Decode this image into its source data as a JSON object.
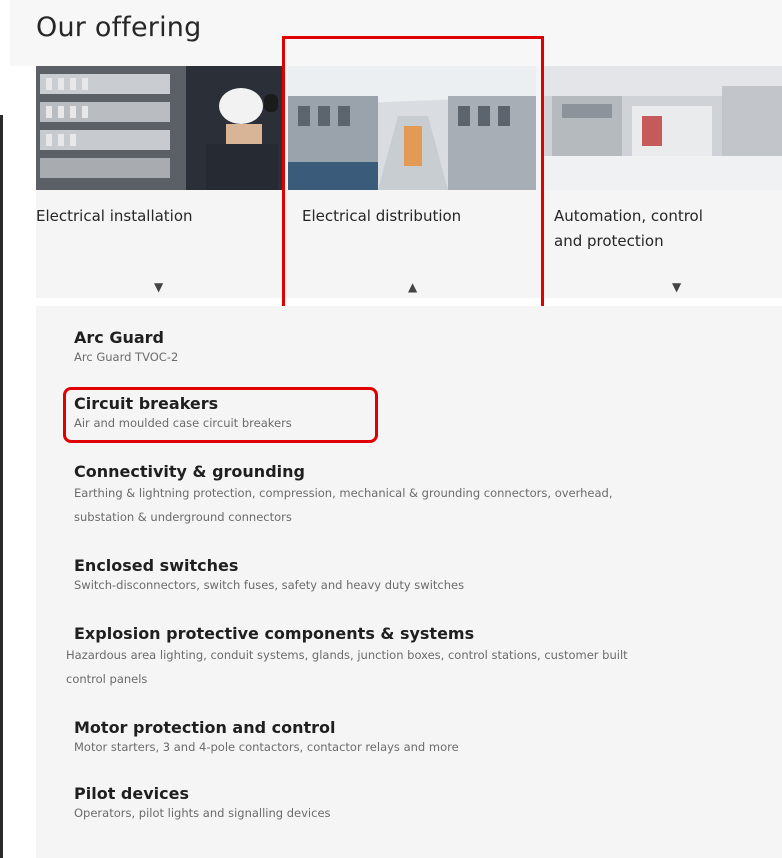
{
  "page": {
    "title": "Our offering"
  },
  "categories": [
    {
      "label_lines": [
        "Electrical installation"
      ],
      "caret": "▼"
    },
    {
      "label_lines": [
        "Electrical distribution"
      ],
      "caret": "▲"
    },
    {
      "label_lines": [
        "Automation, control",
        "and protection"
      ],
      "caret": "▼"
    }
  ],
  "products": [
    {
      "title": "Arc Guard",
      "desc_lines": [
        "Arc Guard TVOC-2"
      ]
    },
    {
      "title": "Circuit breakers",
      "desc_lines": [
        "Air and moulded case circuit breakers"
      ]
    },
    {
      "title": "Connectivity & grounding",
      "desc_lines": [
        "Earthing & lightning protection, compression, mechanical & grounding connectors, overhead,",
        "substation & underground connectors"
      ]
    },
    {
      "title": "Enclosed switches",
      "desc_lines": [
        "Switch-disconnectors, switch fuses, safety and heavy duty switches"
      ]
    },
    {
      "title": "Explosion protective components & systems",
      "desc_lines": [
        "Hazardous area lighting, conduit systems, glands, junction boxes, control stations, customer built",
        "control panels"
      ]
    },
    {
      "title": "Motor protection and control",
      "desc_lines": [
        "Motor starters, 3 and 4-pole contactors, contactor relays and more"
      ]
    },
    {
      "title": "Pilot devices",
      "desc_lines": [
        "Operators, pilot lights and signalling devices"
      ]
    }
  ],
  "colors": {
    "highlight": "#e00000",
    "panel": "#f5f5f5"
  }
}
